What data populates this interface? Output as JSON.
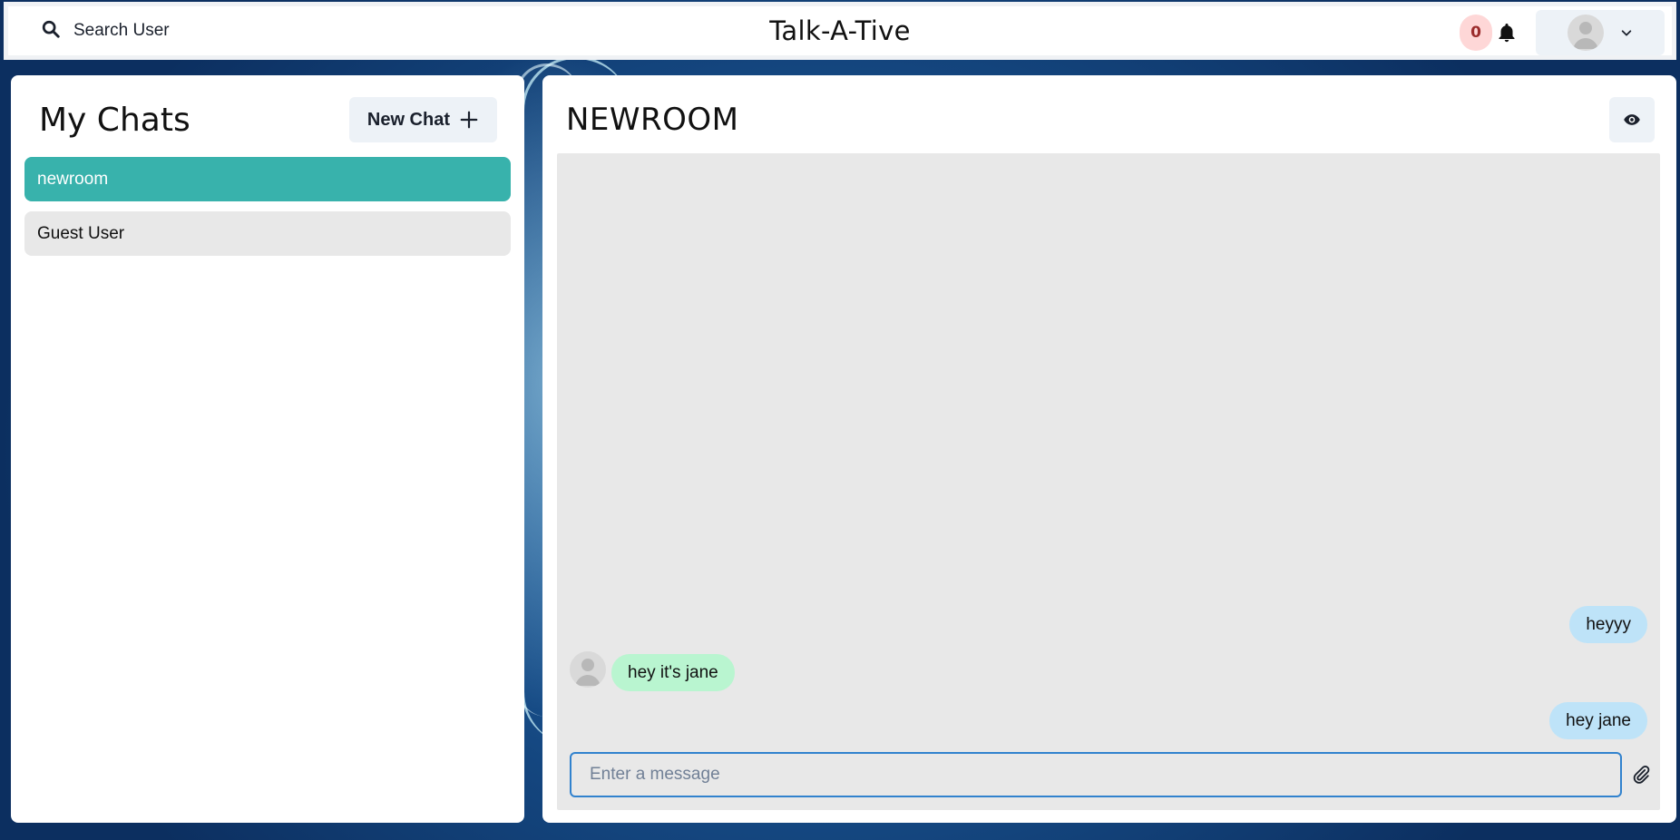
{
  "header": {
    "search_label": "Search User",
    "app_title": "Talk-A-Tive",
    "notification_count": "0"
  },
  "sidebar": {
    "title": "My Chats",
    "new_chat_label": "New Chat",
    "chats": [
      {
        "label": "newroom",
        "active": true
      },
      {
        "label": "Guest User",
        "active": false
      }
    ]
  },
  "chat": {
    "room_name": "NEWROOM",
    "messages": [
      {
        "text": "heyyy",
        "sender": "me"
      },
      {
        "text": "hey it's jane",
        "sender": "other"
      },
      {
        "text": "hey jane",
        "sender": "me"
      }
    ],
    "input": {
      "value": "",
      "placeholder": "Enter a message"
    }
  },
  "colors": {
    "active_chat": "#38b2ac",
    "my_bubble": "#bee3f8",
    "their_bubble": "#b9f5d0",
    "badge_bg": "#fed7d7",
    "input_border": "#3182ce"
  },
  "icons": {
    "search": "search-icon",
    "bell": "bell-icon",
    "avatar": "user-avatar-icon",
    "chevron": "chevron-down-icon",
    "plus": "plus-icon",
    "eye": "eye-icon",
    "attach": "paperclip-icon"
  }
}
